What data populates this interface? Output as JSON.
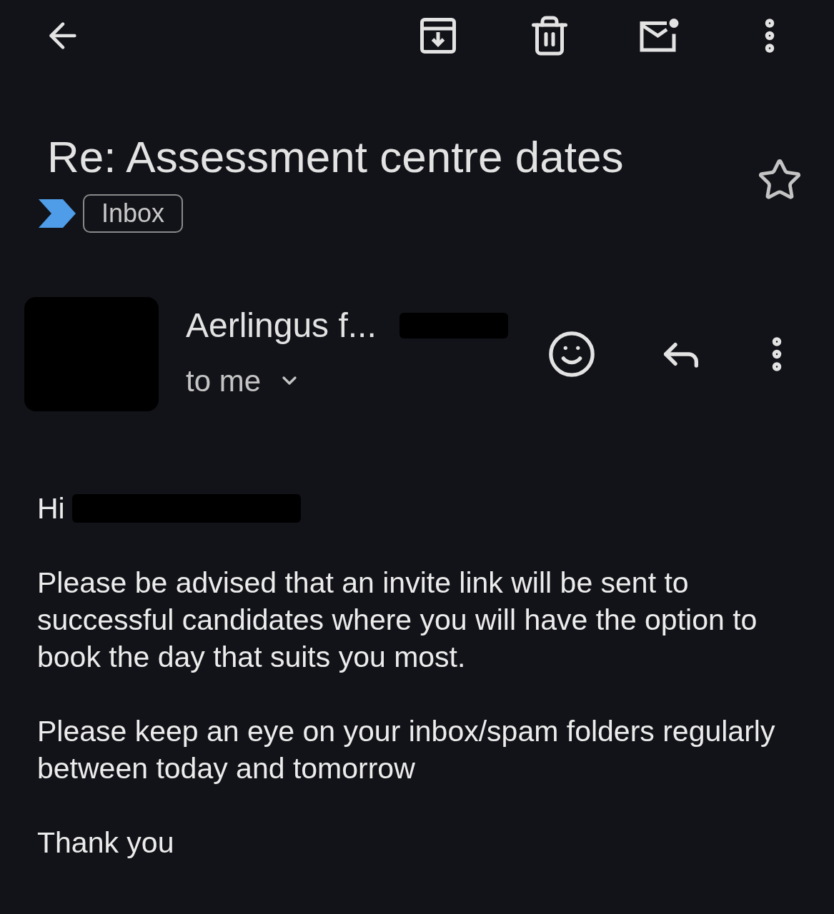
{
  "subject": "Re: Assessment centre dates",
  "starred": false,
  "labels": [
    {
      "text": "Inbox"
    }
  ],
  "message": {
    "sender": "Aerlingus f...",
    "recipient": "to me",
    "greeting": "Hi",
    "paragraphs": [
      "Please be advised that an invite link will be sent to successful candidates where you will have the option to book the day that suits you most.",
      "Please keep an eye on your inbox/spam folders regularly between today and tomorrow",
      "Thank you"
    ]
  }
}
